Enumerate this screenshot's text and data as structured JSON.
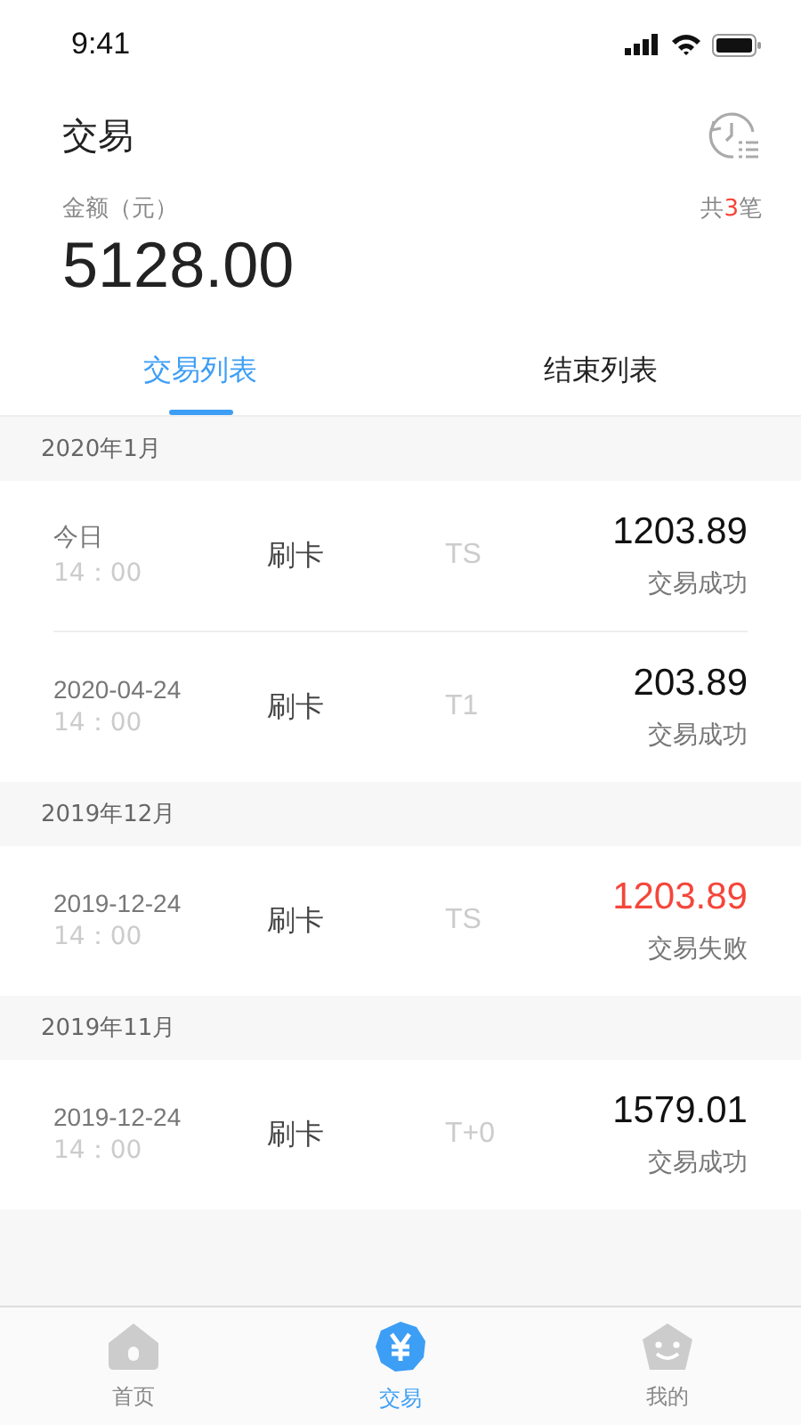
{
  "status_bar": {
    "time": "9:41"
  },
  "header": {
    "title": "交易"
  },
  "summary": {
    "label": "金额（元）",
    "amount": "5128.00",
    "count": {
      "prefix": "共",
      "value": "3",
      "suffix": "笔"
    }
  },
  "tabs": [
    {
      "label": "交易列表",
      "selected": true
    },
    {
      "label": "结束列表",
      "selected": false
    }
  ],
  "groups": [
    {
      "month": "2020年1月",
      "rows": [
        {
          "date": "今日",
          "time": "14：00",
          "method": "刷卡",
          "settlement": "TS",
          "amount": "1203.89",
          "status": "交易成功",
          "failed": false
        },
        {
          "date": "2020-04-24",
          "time": "14：00",
          "method": "刷卡",
          "settlement": "T1",
          "amount": "203.89",
          "status": "交易成功",
          "failed": false
        }
      ]
    },
    {
      "month": "2019年12月",
      "rows": [
        {
          "date": "2019-12-24",
          "time": "14：00",
          "method": "刷卡",
          "settlement": "TS",
          "amount": "1203.89",
          "status": "交易失败",
          "failed": true
        }
      ]
    },
    {
      "month": "2019年11月",
      "rows": [
        {
          "date": "2019-12-24",
          "time": "14：00",
          "method": "刷卡",
          "settlement": "T+0",
          "amount": "1579.01",
          "status": "交易成功",
          "failed": false
        }
      ]
    }
  ],
  "bottom_nav": [
    {
      "label": "首页",
      "kind": "home",
      "selected": false
    },
    {
      "label": "交易",
      "kind": "trade",
      "selected": true
    },
    {
      "label": "我的",
      "kind": "me",
      "selected": false
    }
  ]
}
